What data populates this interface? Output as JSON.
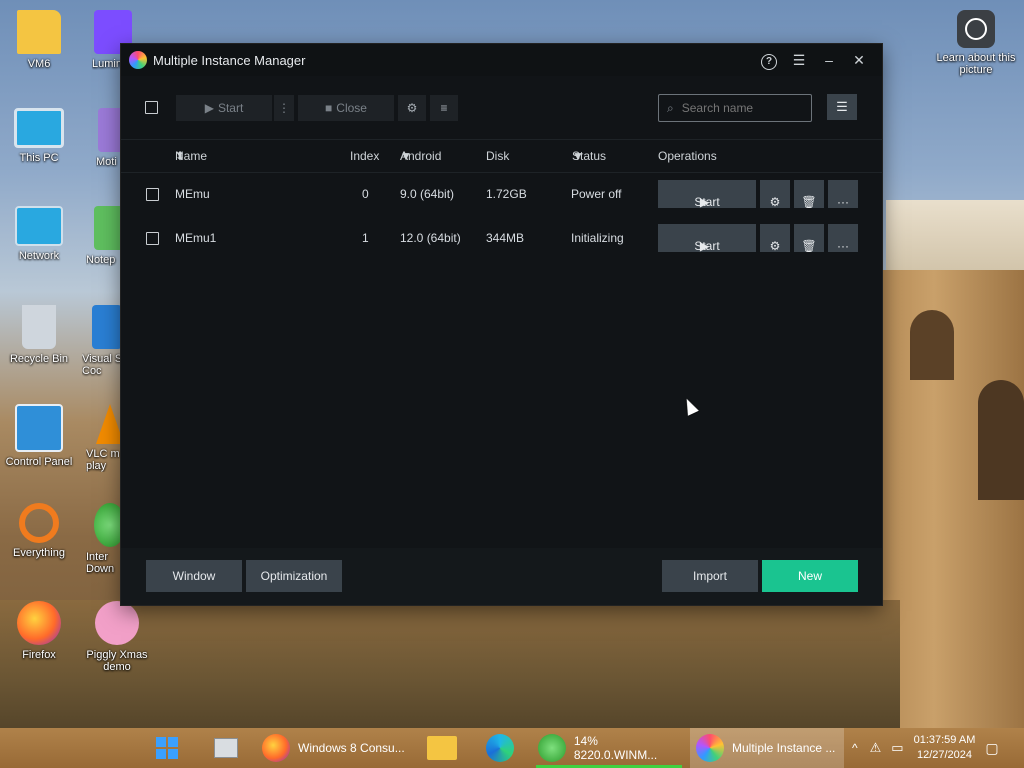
{
  "desktop": {
    "icons": [
      {
        "label": "VM6",
        "color": "#f4c542"
      },
      {
        "label": "This PC",
        "color": "#29a8e0"
      },
      {
        "label": "Network",
        "color": "#29a8e0"
      },
      {
        "label": "Recycle Bin",
        "color": "#cfd6dd"
      },
      {
        "label": "Control Panel",
        "color": "#2f8fd8"
      },
      {
        "label": "Everything",
        "color": "#f07b1e"
      },
      {
        "label": "Firefox",
        "color": "#ff6a2a"
      },
      {
        "label": "Lumin",
        "color": "#7c4dff"
      },
      {
        "label": "Moti",
        "color": "#9b7ad8"
      },
      {
        "label": "Notep",
        "color": "#5fbf5f"
      },
      {
        "label": "Visual S Coc",
        "color": "#2a7fd4"
      },
      {
        "label": "VLC m play",
        "color": "#f28b00"
      },
      {
        "label": "Inter Down",
        "color": "#3fae3f"
      },
      {
        "label": "Piggly Xmas demo",
        "color": "#f2a0c8"
      },
      {
        "label": "Learn about this picture",
        "color": "#3b3f44"
      }
    ]
  },
  "window": {
    "title": "Multiple Instance Manager",
    "controls": {
      "help": "?",
      "menu": "☰",
      "minimize": "–",
      "close": "✕"
    },
    "toolbar": {
      "start_label": "Start",
      "close_label": "Close",
      "search_placeholder": "Search name"
    },
    "columns": {
      "name": "Name",
      "index": "Index",
      "android": "Android",
      "disk": "Disk",
      "status": "Status",
      "operations": "Operations"
    },
    "rows": [
      {
        "name": "MEmu",
        "index": "0",
        "android": "9.0 (64bit)",
        "disk": "1.72GB",
        "status": "Power off",
        "start_label": "Start"
      },
      {
        "name": "MEmu1",
        "index": "1",
        "android": "12.0 (64bit)",
        "disk": "344MB",
        "status": "Initializing",
        "start_label": "Start"
      }
    ],
    "footer": {
      "window_label": "Window",
      "optimization_label": "Optimization",
      "import_label": "Import",
      "new_label": "New"
    },
    "colors": {
      "accent": "#1ac490",
      "background": "#111417",
      "button": "#3a434b"
    }
  },
  "taskbar": {
    "items": [
      {
        "label": "Windows 8 Consu..."
      },
      {
        "label": "14% 8220.0.WINM..."
      },
      {
        "label": "Multiple Instance ..."
      }
    ],
    "clock": {
      "time": "01:37:59 AM",
      "date": "12/27/2024"
    }
  }
}
